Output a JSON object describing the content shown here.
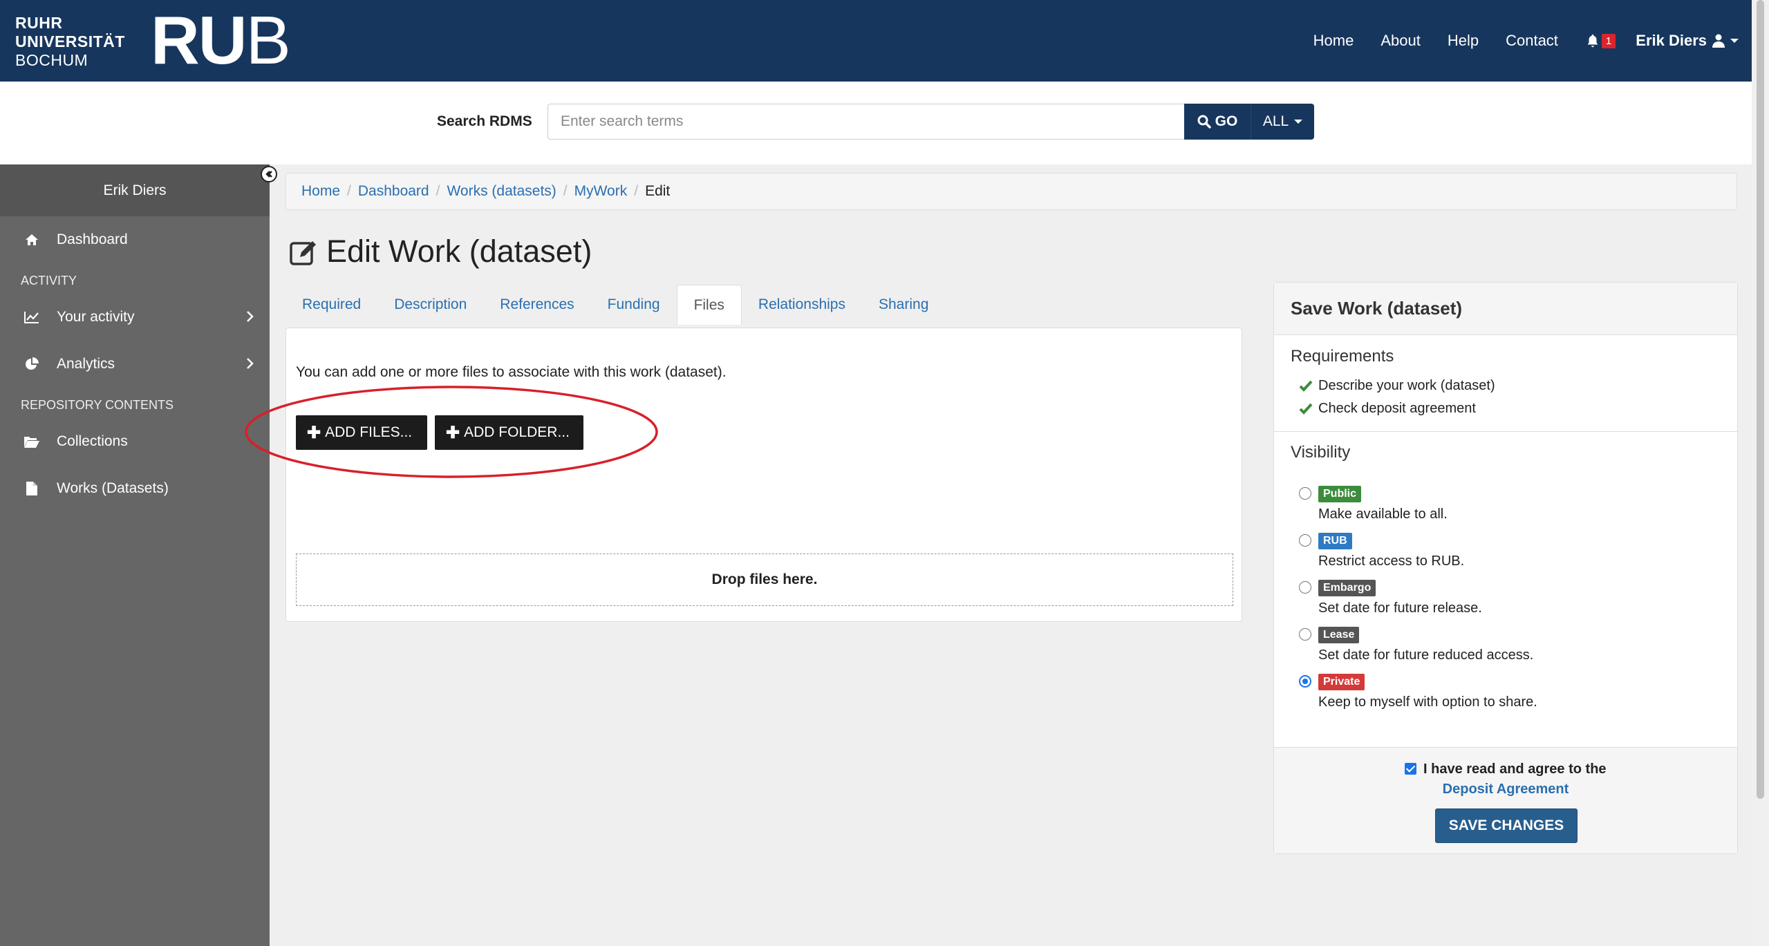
{
  "header": {
    "logo_line1": "RUHR",
    "logo_line2": "UNIVERSITÄT",
    "logo_line3": "BOCHUM",
    "logo_big_bold": "RU",
    "logo_big_light": "B",
    "nav": [
      "Home",
      "About",
      "Help",
      "Contact"
    ],
    "notification_count": "1",
    "user_name": "Erik Diers"
  },
  "search": {
    "label": "Search RDMS",
    "placeholder": "Enter search terms",
    "go_label": "GO",
    "scope_label": "ALL"
  },
  "sidebar": {
    "user": "Erik Diers",
    "dashboard": "Dashboard",
    "activity_heading": "ACTIVITY",
    "your_activity": "Your activity",
    "analytics": "Analytics",
    "repo_heading": "REPOSITORY CONTENTS",
    "collections": "Collections",
    "works": "Works (Datasets)"
  },
  "breadcrumb": [
    "Home",
    "Dashboard",
    "Works (datasets)",
    "MyWork",
    "Edit"
  ],
  "title": "Edit Work (dataset)",
  "tabs": [
    "Required",
    "Description",
    "References",
    "Funding",
    "Files",
    "Relationships",
    "Sharing"
  ],
  "active_tab": "Files",
  "files": {
    "intro": "You can add one or more files to associate with this work (dataset).",
    "add_files": "ADD FILES...",
    "add_folder": "ADD FOLDER...",
    "drop": "Drop files here."
  },
  "save_panel": {
    "title": "Save Work (dataset)",
    "requirements_title": "Requirements",
    "requirements": [
      "Describe your work (dataset)",
      "Check deposit agreement"
    ],
    "visibility_title": "Visibility",
    "visibility": [
      {
        "badge": "Public",
        "color": "#3c8c3c",
        "desc": "Make available to all.",
        "checked": false
      },
      {
        "badge": "RUB",
        "color": "#2e7bc4",
        "desc": "Restrict access to RUB.",
        "checked": false
      },
      {
        "badge": "Embargo",
        "color": "#555555",
        "desc": "Set date for future release.",
        "checked": false
      },
      {
        "badge": "Lease",
        "color": "#555555",
        "desc": "Set date for future reduced access.",
        "checked": false
      },
      {
        "badge": "Private",
        "color": "#d33a3a",
        "desc": "Keep to myself with option to share.",
        "checked": true
      }
    ],
    "agree_text": "I have read and agree to the",
    "agree_link": "Deposit Agreement",
    "save_label": "SAVE CHANGES"
  },
  "colors": {
    "header_bg": "#17365d",
    "sidebar_bg": "#666666",
    "link": "#2a6fb0",
    "annotation": "#d8202a"
  }
}
